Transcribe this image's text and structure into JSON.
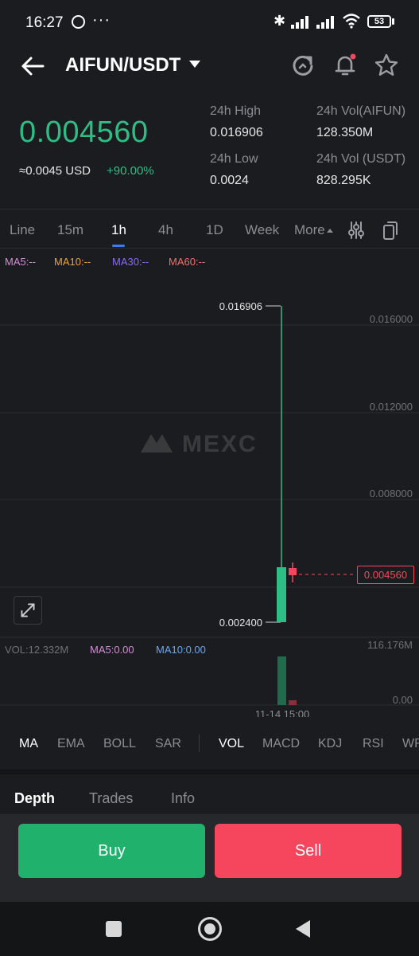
{
  "status_bar": {
    "time": "16:27",
    "more": "···",
    "battery": "53"
  },
  "header": {
    "pair": "AIFUN/USDT",
    "icons": [
      "back-arrow-icon",
      "refresh-icon",
      "bell-icon",
      "star-icon"
    ]
  },
  "ticker": {
    "last_price": "0.004560",
    "usd_price": "≈0.0045 USD",
    "change": "+90.00%",
    "high_label": "24h High",
    "high_value": "0.016906",
    "low_label": "24h Low",
    "low_value": "0.0024",
    "vol_base_label": "24h Vol(AIFUN)",
    "vol_base_value": "128.350M",
    "vol_quote_label": "24h Vol (USDT)",
    "vol_quote_value": "828.295K"
  },
  "timeframes": [
    "Line",
    "15m",
    "1h",
    "4h",
    "1D",
    "Week",
    "More"
  ],
  "active_timeframe": "1h",
  "ma_legend": {
    "ma5": "MA5:--",
    "ma10": "MA10:--",
    "ma30": "MA30:--",
    "ma60": "MA60:--"
  },
  "chart": {
    "watermark": "MEXC",
    "y_ticks": [
      "0.016000",
      "0.012000",
      "0.008000"
    ],
    "high_marker": "0.016906",
    "low_marker": "0.002400",
    "current_price_tag": "0.004560",
    "vol_max_label": "116.176M",
    "vol_zero_label": "0.00",
    "time_label": "11-14 15:00"
  },
  "chart_data": {
    "type": "candlestick",
    "interval": "1h",
    "candles": [
      {
        "time": "11-14 15:00",
        "open": 0.0024,
        "high": 0.016906,
        "low": 0.0024,
        "close": 0.005
      },
      {
        "time": "",
        "open": 0.00456,
        "high": 0.0049,
        "low": 0.0043,
        "close": 0.00456
      }
    ],
    "volume": [
      116.176,
      12.332
    ],
    "ylim": [
      0.0,
      0.018
    ]
  },
  "vol_legend": {
    "vol": "VOL:12.332M",
    "ma5": "MA5:0.00",
    "ma10": "MA10:0.00"
  },
  "indicators": [
    "MA",
    "EMA",
    "BOLL",
    "SAR",
    "VOL",
    "MACD",
    "KDJ",
    "RSI",
    "WR"
  ],
  "bottom_tabs": [
    "Depth",
    "Trades",
    "Info"
  ],
  "actions": {
    "buy": "Buy",
    "sell": "Sell"
  },
  "colors": {
    "up": "#2ebd85",
    "down": "#f6465d",
    "accent": "#3b7cf6"
  }
}
